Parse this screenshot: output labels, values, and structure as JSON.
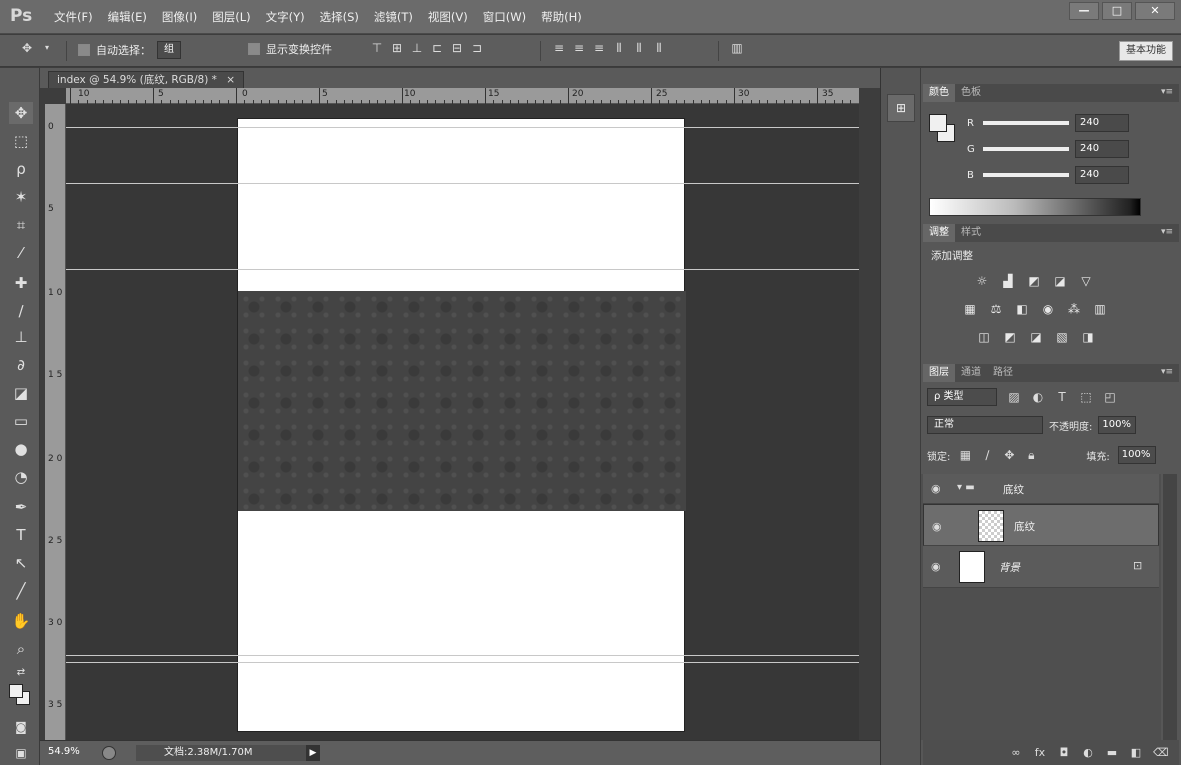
{
  "app": {
    "logo": "Ps"
  },
  "menu": [
    "文件(F)",
    "编辑(E)",
    "图像(I)",
    "图层(L)",
    "文字(Y)",
    "选择(S)",
    "滤镜(T)",
    "视图(V)",
    "窗口(W)",
    "帮助(H)"
  ],
  "window_controls": {
    "minimize": "—",
    "restore": "□",
    "close": "✕"
  },
  "options": {
    "auto_select_label": "自动选择：",
    "auto_select_value": "组",
    "show_transform_label": "显示变换控件",
    "workspace": "基本功能"
  },
  "document": {
    "tab_title": "index @ 54.9% (底纹, RGB/8) *",
    "tab_close": "×"
  },
  "ruler": {
    "h_labels": [
      "10",
      "5",
      "0",
      "5",
      "10",
      "15",
      "20",
      "25",
      "30",
      "35"
    ],
    "v_labels": [
      "0",
      "5",
      "1 0",
      "1 5",
      "2 0",
      "2 5",
      "3 0",
      "3 5"
    ]
  },
  "status": {
    "zoom": "54.9%",
    "doc_size": "文档:2.38M/1.70M",
    "arrow": "▶"
  },
  "color_panel": {
    "tabs": [
      "颜色",
      "色板"
    ],
    "channels": [
      {
        "label": "R",
        "value": "240"
      },
      {
        "label": "G",
        "value": "240"
      },
      {
        "label": "B",
        "value": "240"
      }
    ],
    "fg_color": "#f0f0f0"
  },
  "adjust_panel": {
    "tabs": [
      "调整",
      "样式"
    ],
    "heading": "添加调整"
  },
  "layers_panel": {
    "tabs": [
      "图层",
      "通道",
      "路径"
    ],
    "filter_label": "ρ 类型",
    "blend_mode": "正常",
    "opacity_label": "不透明度:",
    "opacity_value": "100%",
    "lock_label": "锁定:",
    "fill_label": "填充:",
    "fill_value": "100%",
    "layers": [
      {
        "name": "底纹",
        "kind": "group"
      },
      {
        "name": "底纹",
        "kind": "layer"
      },
      {
        "name": "背景",
        "kind": "background"
      }
    ]
  }
}
